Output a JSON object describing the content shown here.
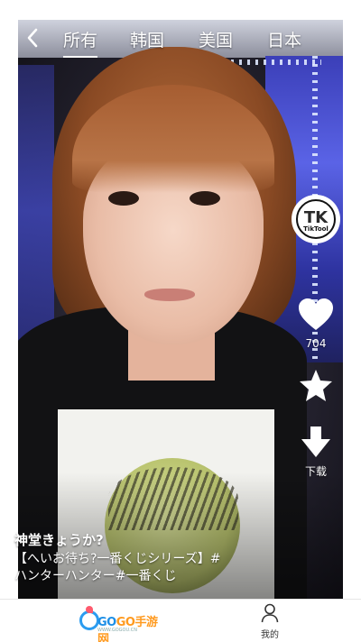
{
  "nav": {
    "tabs": [
      {
        "label": "所有",
        "active": true
      },
      {
        "label": "韩国",
        "active": false
      },
      {
        "label": "美国",
        "active": false
      },
      {
        "label": "日本",
        "active": false
      }
    ]
  },
  "actions": {
    "profile_badge": "TK",
    "profile_label": "TikTool",
    "like_count": "704",
    "download_label": "下载"
  },
  "caption": {
    "author": "神堂きょうか?",
    "description_line1": "【へいお待ち?一番くじシリーズ】#",
    "description_line2": "ハンターハンター#一番くじ"
  },
  "bottom_bar": {
    "brand_text_a": "GO",
    "brand_text_b": "GO手游网",
    "brand_sub": "WWW.GOGOU.CN",
    "me_label": "我的"
  },
  "colors": {
    "brand_blue": "#1d8fe6",
    "brand_orange": "#ff9a1f",
    "icon_white": "#ffffff"
  },
  "icons": {
    "back": "chevron-left-icon",
    "like": "heart-icon",
    "favorite": "star-icon",
    "download": "download-arrow-icon",
    "me": "user-icon"
  }
}
